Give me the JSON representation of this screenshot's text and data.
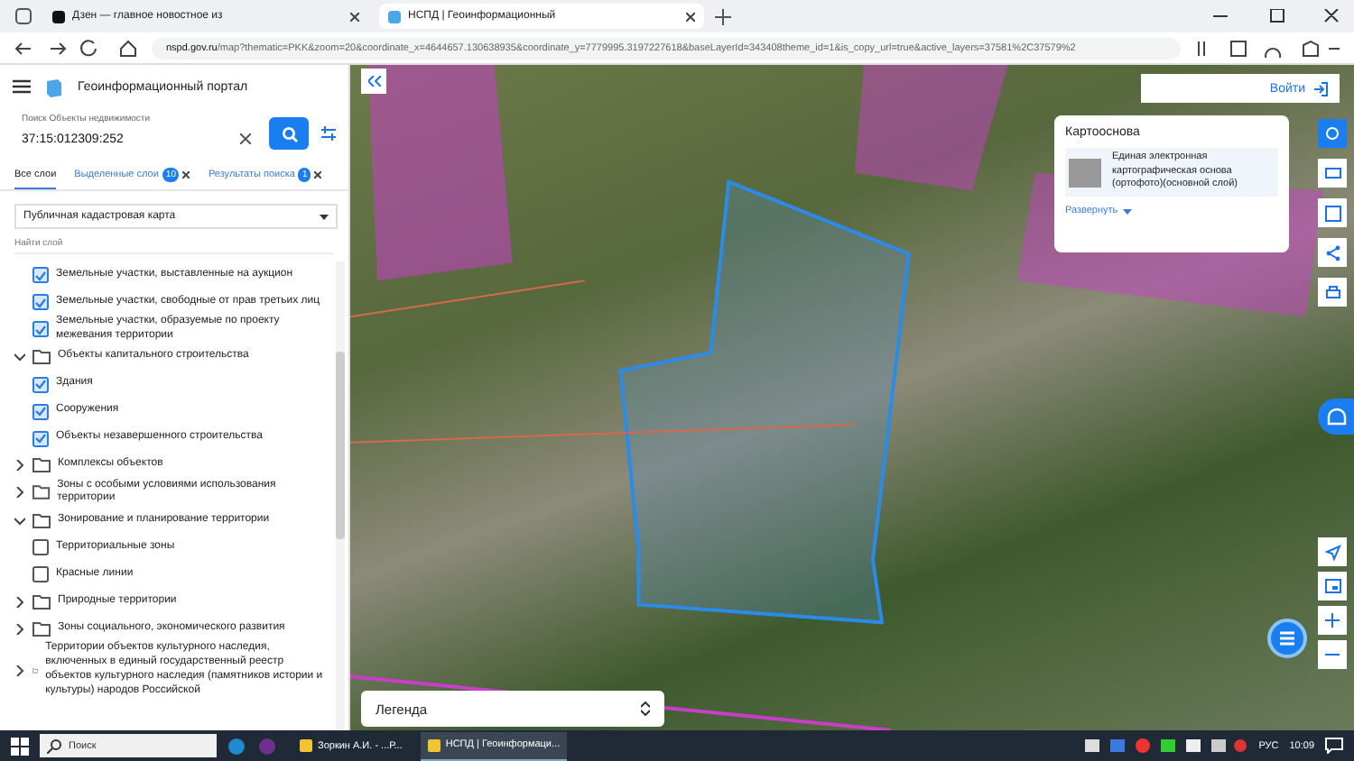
{
  "browser": {
    "tabs": [
      {
        "title": "Дзен — главное новостное из",
        "selected": false
      },
      {
        "title": "НСПД | Геоинформационный",
        "selected": true
      }
    ],
    "url_domain": "nspd.gov.ru",
    "url_path": "/map?thematic=PKK&zoom=20&coordinate_x=4644657.130638935&coordinate_y=7779995.3197227618&baseLayerId=343408theme_id=1&is_copy_url=true&active_layers=37581%2C37579%2"
  },
  "portal": {
    "title": "Геоинформационный портал"
  },
  "search": {
    "label": "Поиск Объекты недвижимости",
    "value": "37:15:012309:252"
  },
  "tabs": [
    {
      "label": "Все слои",
      "selected": true
    },
    {
      "label": "Выделенные слои",
      "badge": "10",
      "selected": false
    },
    {
      "label": "Результаты поиска",
      "badge": "1",
      "selected": false
    }
  ],
  "map_select": {
    "value": "Публичная кадастровая карта"
  },
  "layer_search": {
    "placeholder": "Найти слой"
  },
  "layers": [
    {
      "kind": "layer",
      "label": "Земельные участки, выставленные на аукцион",
      "checked": true
    },
    {
      "kind": "layer",
      "label": "Земельные участки, свободные от прав третьих лиц",
      "checked": true
    },
    {
      "kind": "layer",
      "label": "Земельные участки, образуемые по проекту межевания территории",
      "checked": true
    },
    {
      "kind": "folder",
      "label": "Объекты капитального строительства",
      "expanded": true,
      "children": [
        {
          "kind": "layer",
          "label": "Здания",
          "checked": true
        },
        {
          "kind": "layer",
          "label": "Сооружения",
          "checked": true
        },
        {
          "kind": "layer",
          "label": "Объекты незавершенного строительства",
          "checked": true
        }
      ]
    },
    {
      "kind": "folder",
      "label": "Комплексы объектов",
      "expanded": false
    },
    {
      "kind": "folder",
      "label": "Зоны с особыми условиями использования территории",
      "expanded": false
    },
    {
      "kind": "folder",
      "label": "Зонирование и планирование территории",
      "expanded": true,
      "children": [
        {
          "kind": "layer",
          "label": "Территориальные зоны",
          "checked": false
        },
        {
          "kind": "layer",
          "label": "Красные линии",
          "checked": false
        }
      ]
    },
    {
      "kind": "folder",
      "label": "Природные территории",
      "expanded": false
    },
    {
      "kind": "folder",
      "label": "Зоны социального, экономического развития",
      "expanded": false
    },
    {
      "kind": "folder",
      "label": "Территории объектов культурного наследия, включенных в единый государственный реестр объектов культурного наследия (памятников истории и культуры) народов Российской",
      "expanded": false
    }
  ],
  "login": {
    "label": "Войти"
  },
  "basemap": {
    "title": "Картооснова",
    "layer": "Единая электронная картографическая основа (ортофото)(основной слой)",
    "expand": "Развернуть"
  },
  "legend": {
    "label": "Легенда"
  },
  "taskbar": {
    "search": "Поиск",
    "apps": [
      {
        "title": "Зоркин А.И. - ...Р...",
        "selected": false
      },
      {
        "title": "НСПД | Геоинформаци...",
        "selected": true
      }
    ],
    "lang": "РУС",
    "time": "10:09"
  }
}
